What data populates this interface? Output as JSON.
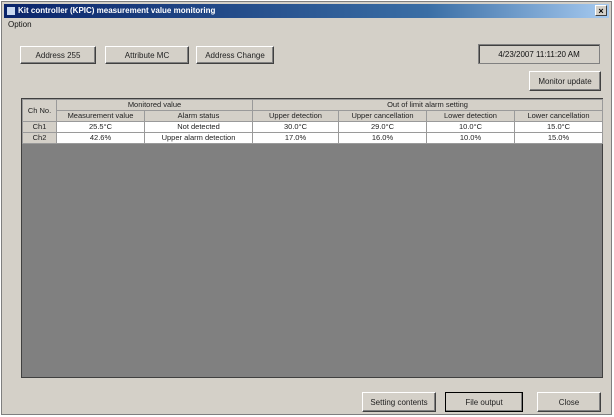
{
  "window": {
    "title": "Kit controller (KPIC) measurement value monitoring",
    "close_glyph": "×"
  },
  "menu": {
    "option_label": "Option"
  },
  "toolbar": {
    "address_btn": "Address 255",
    "attribute_btn": "Attribute MC",
    "address_change_btn": "Address Change",
    "datetime": "4/23/2007 11:11:20 AM",
    "monitor_update_btn": "Monitor update"
  },
  "table": {
    "header_ch_no": "Ch No.",
    "group_monitored": "Monitored value",
    "group_alarm": "Out of limit alarm setting",
    "columns": [
      "Measurement value",
      "Alarm status",
      "Upper detection",
      "Upper cancellation",
      "Lower detection",
      "Lower cancellation"
    ],
    "rows": [
      {
        "ch": "Ch1",
        "cells": [
          "25.5°C",
          "Not detected",
          "30.0°C",
          "29.0°C",
          "10.0°C",
          "15.0°C"
        ]
      },
      {
        "ch": "Ch2",
        "cells": [
          "42.6%",
          "Upper alarm detection",
          "17.0%",
          "16.0%",
          "10.0%",
          "15.0%"
        ]
      }
    ]
  },
  "footer": {
    "setting_contents_btn": "Setting contents",
    "file_output_btn": "File output",
    "close_btn": "Close"
  }
}
